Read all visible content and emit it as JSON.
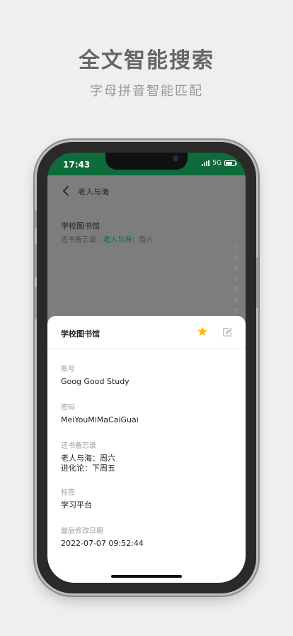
{
  "promo": {
    "title": "全文智能搜索",
    "subtitle": "字母拼音智能匹配"
  },
  "status_bar": {
    "time": "17:43",
    "network": "5G",
    "background_color": "#0e6b3a"
  },
  "nav": {
    "back_icon": "chevron-left-icon",
    "title": "老人与海"
  },
  "list": {
    "item_title": "学校图书馆",
    "memo_prefix": "还书备忘录：",
    "memo_highlight": "老人与海",
    "memo_suffix": "：周六",
    "highlight_color": "#0e6b3a"
  },
  "index_bar": [
    "☆",
    "A",
    "B",
    "C",
    "D",
    "E",
    "F"
  ],
  "detail_sheet": {
    "title": "学校图书馆",
    "favorite_icon": "star-icon",
    "favorite_color": "#f5b914",
    "edit_icon": "edit-icon",
    "fields": [
      {
        "label": "账号",
        "value": "Goog Good Study"
      },
      {
        "label": "密码",
        "value": "MeiYouMiMaCaiGuai"
      },
      {
        "label": "还书备忘录",
        "value_lines": [
          "老人与海：周六",
          "进化论：下周五"
        ]
      },
      {
        "label": "标签",
        "value": "学习平台"
      },
      {
        "label": "最后修改日期",
        "value": "2022-07-07 09:52:44"
      }
    ]
  }
}
